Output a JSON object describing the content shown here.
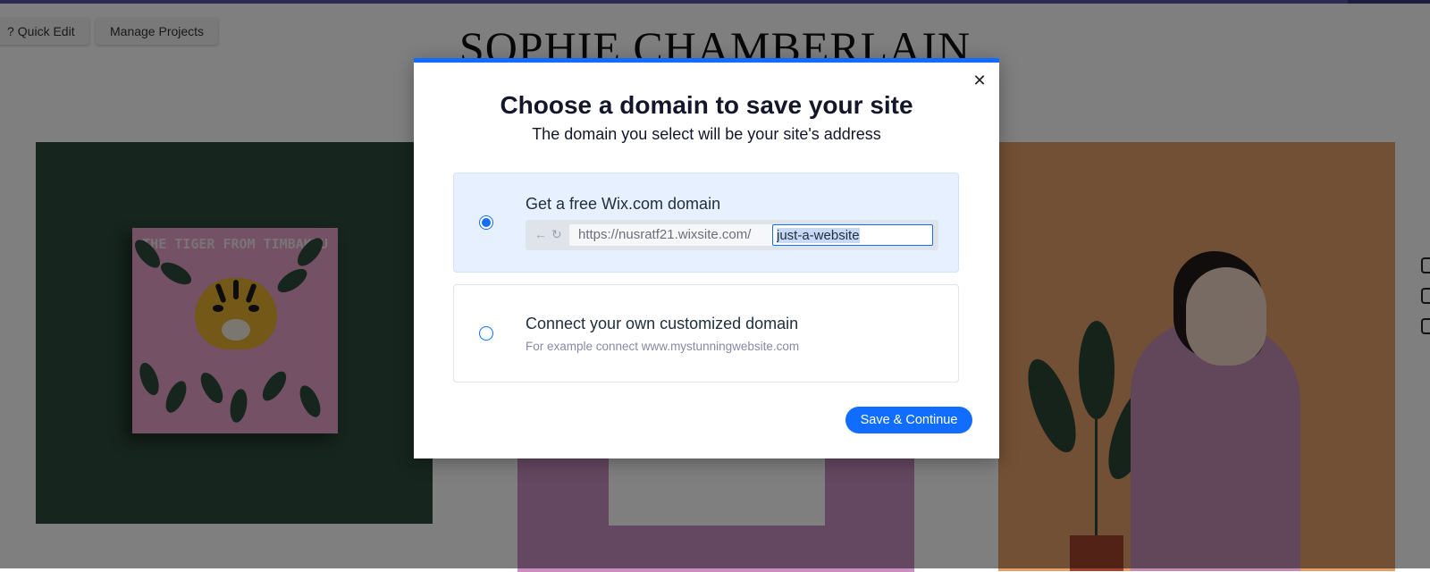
{
  "editor": {
    "quick_edit_label": "Quick Edit",
    "manage_projects_label": "Manage Projects"
  },
  "site": {
    "title": "SOPHIE CHAMBERLAIN",
    "book_title": "THE TIGER FROM TIMBAKTU"
  },
  "modal": {
    "title": "Choose a domain to save your site",
    "subtitle": "The domain you select will be your site's address",
    "close_icon": "close-icon",
    "free_option": {
      "label": "Get a free Wix.com domain",
      "selected": true,
      "url_prefix": "https://nusratf21.wixsite.com/",
      "url_value": "just-a-website",
      "back_icon": "arrow-left-icon",
      "refresh_icon": "refresh-icon"
    },
    "custom_option": {
      "label": "Connect your own customized domain",
      "hint": "For example connect www.mystunningwebsite.com",
      "selected": false
    },
    "save_button": "Save & Continue"
  },
  "colors": {
    "accent": "#116dff",
    "selected_option_bg": "#e7f0ff"
  }
}
